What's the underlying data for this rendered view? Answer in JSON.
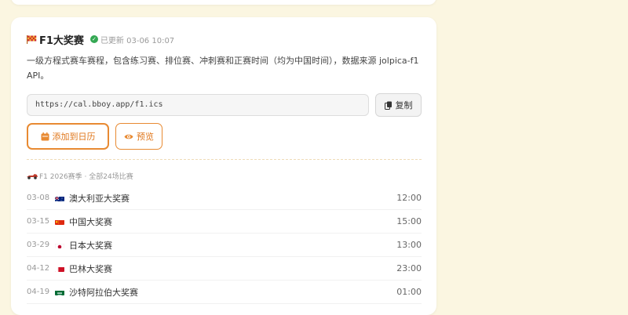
{
  "card": {
    "title": "F1大奖赛",
    "updated": "已更新 03-06 10:07",
    "description": "一级方程式赛车赛程，包含练习赛、排位赛、冲刺赛和正赛时间（均为中国时间），数据来源 jolpica-f1 API。",
    "url": "https://cal.bboy.app/f1.ics",
    "copy_label": "复制",
    "add_label": "添加到日历",
    "preview_label": "预览",
    "season_label": "F1 2026赛季 · 全部24场比赛"
  },
  "races": [
    {
      "date": "03-08",
      "flag": "australia",
      "name": "澳大利亚大奖赛",
      "time": "12:00"
    },
    {
      "date": "03-15",
      "flag": "china",
      "name": "中国大奖赛",
      "time": "15:00"
    },
    {
      "date": "03-29",
      "flag": "japan",
      "name": "日本大奖赛",
      "time": "13:00"
    },
    {
      "date": "04-12",
      "flag": "bahrain",
      "name": "巴林大奖赛",
      "time": "23:00"
    },
    {
      "date": "04-19",
      "flag": "saudi-arabia",
      "name": "沙特阿拉伯大奖赛",
      "time": "01:00"
    }
  ],
  "colors": {
    "background": "#fbf6e1",
    "accent": "#e88a32",
    "success": "#34a853"
  }
}
